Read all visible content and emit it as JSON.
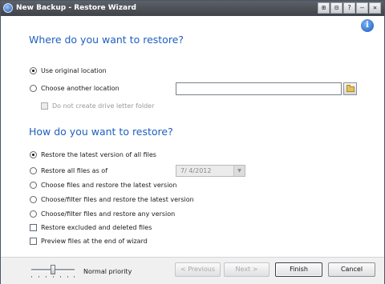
{
  "window": {
    "title": "New Backup - Restore Wizard",
    "controls": [
      "⊞",
      "⊟",
      "?",
      "—",
      "✕"
    ]
  },
  "help_icon_glyph": "i",
  "restore_location": {
    "heading": "Where do you want to restore?",
    "options": [
      {
        "label": "Use original location",
        "selected": true
      },
      {
        "label": "Choose another location",
        "selected": false
      }
    ],
    "path_value": "",
    "subcheck_label": "Do not create drive letter folder"
  },
  "restore_mode": {
    "heading": "How do you want to restore?",
    "options": [
      {
        "label": "Restore the latest version of all files",
        "selected": true
      },
      {
        "label": "Restore all files as of",
        "selected": false
      },
      {
        "label": "Choose files and restore the latest version",
        "selected": false
      },
      {
        "label": "Choose/filter files and restore the latest version",
        "selected": false
      },
      {
        "label": "Choose/filter files and restore any version",
        "selected": false
      }
    ],
    "date_value": "7/  4/2012",
    "checks": [
      {
        "label": "Restore excluded and deleted files",
        "checked": false
      },
      {
        "label": "Preview files at the end of wizard",
        "checked": false
      }
    ]
  },
  "footer": {
    "priority_label": "Normal priority",
    "priority_level": 0.5,
    "buttons": {
      "previous": "< Previous",
      "next": "Next >",
      "finish": "Finish",
      "cancel": "Cancel"
    }
  },
  "colors": {
    "heading": "#1f5fbf",
    "titlebar": "#4a4e55"
  }
}
